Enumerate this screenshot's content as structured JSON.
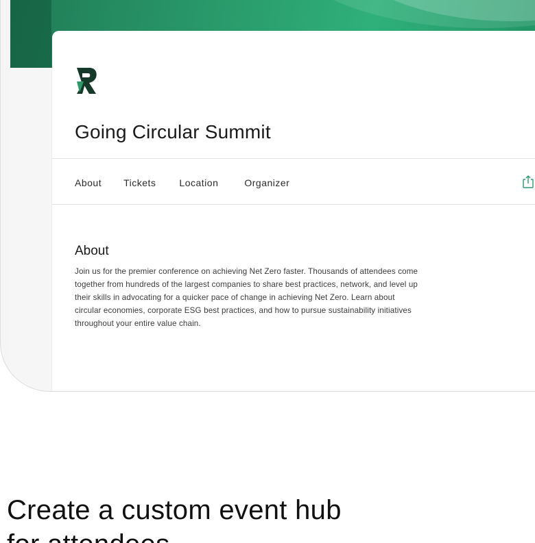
{
  "event": {
    "title": "Going Circular Summit",
    "logo_icon": "r-logo-icon"
  },
  "nav": {
    "tabs": [
      "About",
      "Tickets",
      "Location",
      "Organizer"
    ],
    "share_icon": "share-icon"
  },
  "about": {
    "heading": "About",
    "lines": [
      "Join us for the premier conference on achieving Net Zero faster. Thousands of attendees come",
      "together from hundreds of the largest companies to share best practices, network, and level up",
      "their skills in advocating for a quicker pace of change in achieving Net Zero. Learn about",
      "circular economies, corporate ESG best practices, and how to pursue sustainability initiatives",
      "throughout your entire value chain."
    ]
  },
  "headline": {
    "lines": [
      "Create a custom event hub",
      "for attendees"
    ]
  },
  "colors": {
    "brand_green": "#1f7a54",
    "logo_green": "#2e9a6a",
    "logo_dark": "#163a2a"
  }
}
